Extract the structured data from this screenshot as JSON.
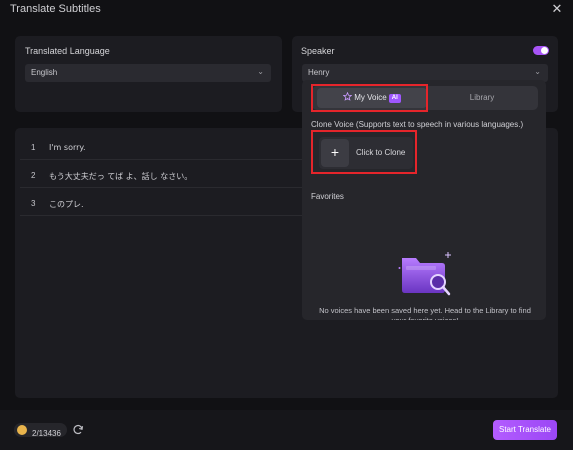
{
  "window": {
    "title": "Translate Subtitles"
  },
  "left_panel": {
    "label": "Translated Language",
    "selected": "English"
  },
  "right_panel": {
    "label": "Speaker",
    "selected": "Henry",
    "toggle_on": true
  },
  "subtitles": [
    {
      "num": "1",
      "text": "I'm sorry."
    },
    {
      "num": "2",
      "text": "もう大丈夫だっ てば よ、話し なさい。"
    },
    {
      "num": "3",
      "text": "このプレ."
    }
  ],
  "voice_dropdown": {
    "tabs": [
      {
        "label": "My Voice",
        "badge": "AI"
      },
      {
        "label": "Library"
      }
    ],
    "clone_heading": "Clone Voice (Supports text to speech in various languages.)",
    "clone_label": "Click to Clone",
    "plus": "+",
    "favorites_heading": "Favorites",
    "empty_text": "No voices have been saved here yet. Head to the Library to find your favorite voices!"
  },
  "footer": {
    "credits": "2/13436",
    "start_button": "Start Translate"
  },
  "colors": {
    "accent": "#a855f7",
    "highlight": "#e5252b",
    "coin": "#e9b44c"
  }
}
